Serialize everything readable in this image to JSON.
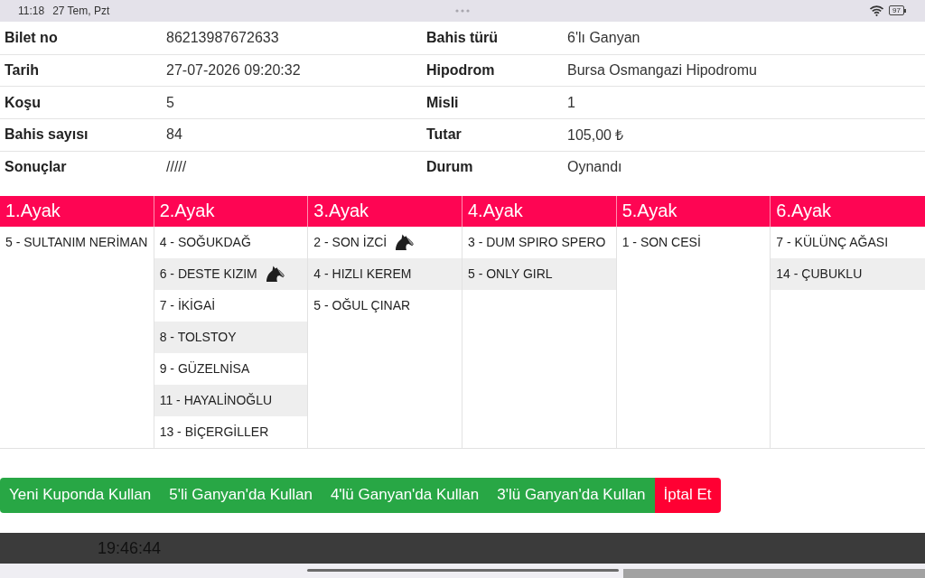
{
  "status_bar": {
    "time": "11:18",
    "date": "27 Tem, Pzt",
    "battery": "97"
  },
  "ticket_details": {
    "rows": [
      {
        "pairs": [
          {
            "label": "Bilet no",
            "value": "86213987672633"
          },
          {
            "label": "Bahis türü",
            "value": "6'lı Ganyan"
          }
        ]
      },
      {
        "pairs": [
          {
            "label": "Tarih",
            "value": "27-07-2026 09:20:32"
          },
          {
            "label": "Hipodrom",
            "value": "Bursa Osmangazi Hipodromu"
          }
        ]
      },
      {
        "pairs": [
          {
            "label": "Koşu",
            "value": "5"
          },
          {
            "label": "Misli",
            "value": "1"
          }
        ]
      },
      {
        "pairs": [
          {
            "label": "Bahis sayısı",
            "value": "84"
          },
          {
            "label": "Tutar",
            "value": "105,00 ₺"
          }
        ]
      },
      {
        "pairs": [
          {
            "label": "Sonuçlar",
            "value": "/////"
          },
          {
            "label": "Durum",
            "value": "Oynandı"
          }
        ]
      }
    ]
  },
  "legs": [
    {
      "title": "1.Ayak",
      "runners": [
        {
          "name": "5 - SULTANIM NERİMAN",
          "horse_icon": false
        }
      ]
    },
    {
      "title": "2.Ayak",
      "runners": [
        {
          "name": "4 - SOĞUKDAĞ",
          "horse_icon": false
        },
        {
          "name": "6 - DESTE KIZIM",
          "horse_icon": true
        },
        {
          "name": "7 - İKİGAİ",
          "horse_icon": false
        },
        {
          "name": "8 - TOLSTOY",
          "horse_icon": false
        },
        {
          "name": "9 - GÜZELNİSA",
          "horse_icon": false
        },
        {
          "name": "11 - HAYALİNOĞLU",
          "horse_icon": false
        },
        {
          "name": "13 - BİÇERGİLLER",
          "horse_icon": false
        }
      ]
    },
    {
      "title": "3.Ayak",
      "runners": [
        {
          "name": "2 - SON İZCİ",
          "horse_icon": true
        },
        {
          "name": "4 - HIZLI KEREM",
          "horse_icon": false
        },
        {
          "name": "5 - OĞUL ÇINAR",
          "horse_icon": false
        }
      ]
    },
    {
      "title": "4.Ayak",
      "runners": [
        {
          "name": "3 - DUM SPIRO SPERO",
          "horse_icon": false
        },
        {
          "name": "5 - ONLY GIRL",
          "horse_icon": false
        }
      ]
    },
    {
      "title": "5.Ayak",
      "runners": [
        {
          "name": "1 - SON CESİ",
          "horse_icon": false
        }
      ]
    },
    {
      "title": "6.Ayak",
      "runners": [
        {
          "name": "7 - KÜLÜNÇ AĞASI",
          "horse_icon": false
        },
        {
          "name": "14 - ÇUBUKLU",
          "horse_icon": false
        }
      ]
    }
  ],
  "actions": [
    {
      "label": "Yeni Kuponda Kullan",
      "kind": "success"
    },
    {
      "label": "5'li Ganyan'da Kullan",
      "kind": "success"
    },
    {
      "label": "4'lü Ganyan'da Kullan",
      "kind": "success"
    },
    {
      "label": "3'lü Ganyan'da Kullan",
      "kind": "success"
    },
    {
      "label": "İptal Et",
      "kind": "danger"
    }
  ],
  "footer": {
    "clock": "19:46:44"
  }
}
